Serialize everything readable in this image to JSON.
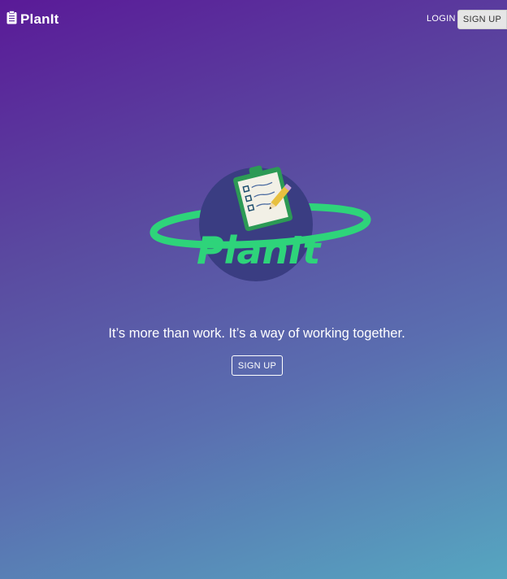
{
  "navbar": {
    "brand_name": "PlanIt",
    "brand_icon": "clipboard-icon",
    "login_label": "LOGIN",
    "signup_label": "SIGN UP"
  },
  "hero": {
    "logo_text": "PlanIt",
    "tagline": "It’s more than work. It’s a way of working together.",
    "signup_label": "SIGN UP"
  },
  "colors": {
    "gradient_start": "#5a1a98",
    "gradient_end": "#56a6c0",
    "logo_planet": "#3a3d82",
    "logo_accent": "#2ed47a",
    "signup_button_bg": "#e6e6e6"
  }
}
